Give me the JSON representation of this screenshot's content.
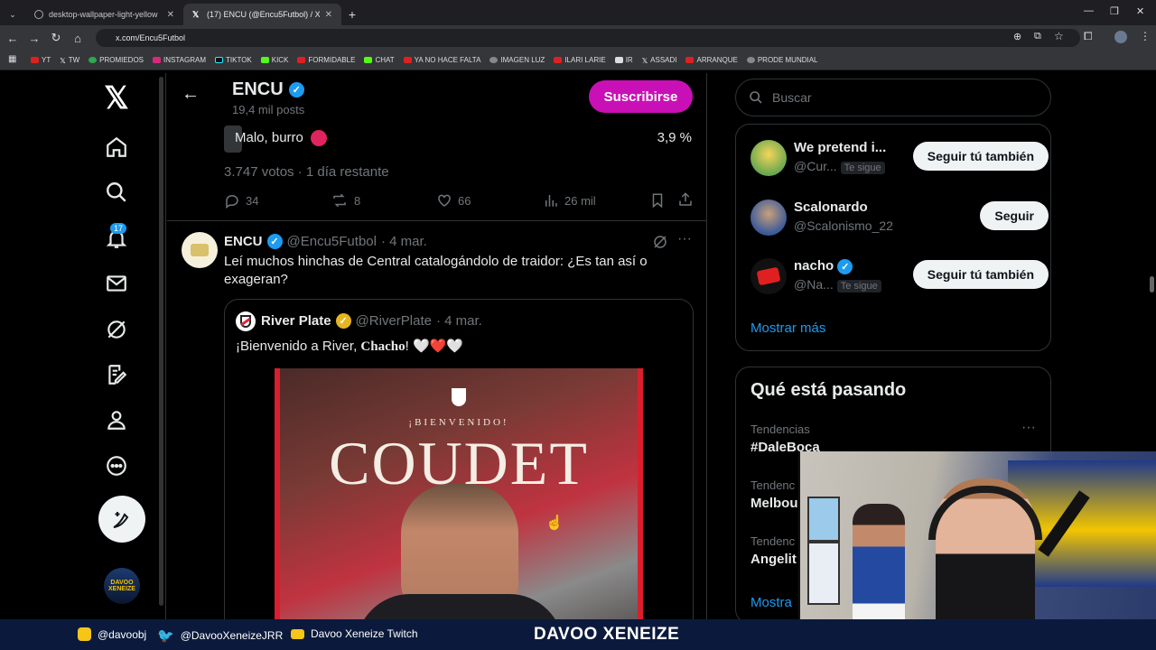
{
  "browser": {
    "tabs": [
      {
        "title": "desktop-wallpaper-light-yellow",
        "active": false
      },
      {
        "title": "(17) ENCU (@Encu5Futbol) / X",
        "active": true
      }
    ],
    "url": "x.com/Encu5Futbol",
    "bookmarks": [
      "YT",
      "TW",
      "PROMIEDOS",
      "INSTAGRAM",
      "TIKTOK",
      "KICK",
      "FORMIDABLE",
      "CHAT",
      "YA NO HACE FALTA",
      "IMAGEN LUZ",
      "ILARI LARIE",
      "IR",
      "ASSADI",
      "ARRANQUE",
      "PRODE MUNDIAL"
    ]
  },
  "nav": {
    "notifications_badge": "17"
  },
  "profile_header": {
    "name": "ENCU",
    "posts": "19,4 mil posts",
    "subscribe": "Suscribirse"
  },
  "poll": {
    "option": "Malo, burro",
    "percent": "3,9 %",
    "percent_value": 3.9,
    "meta": "3.747 votos · 1 día restante",
    "replies": "34",
    "reposts": "8",
    "likes": "66",
    "views": "26 mil"
  },
  "tweet": {
    "name": "ENCU",
    "handle": "@Encu5Futbol",
    "date": "· 4 mar.",
    "text": "Leí muchos hinchas de Central catalogándolo de traidor: ¿Es tan así o exageran?",
    "quote": {
      "name": "River Plate",
      "handle": "@RiverPlate",
      "date": "· 4 mar.",
      "text_before": "¡Bienvenido a River,",
      "text_bold": "Chacho",
      "text_after": "! 🤍❤️🤍",
      "image_subtitle": "¡BIENVENIDO!",
      "image_title": "COUDET"
    }
  },
  "sidebar": {
    "search_placeholder": "Buscar",
    "who_to_follow": [
      {
        "name": "We pretend i...",
        "handle": "@Cur...",
        "te_sigue": "Te sigue",
        "button": "Seguir tú también"
      },
      {
        "name": "Scalonardo",
        "handle": "@Scalonismo_22",
        "te_sigue": "",
        "button": "Seguir"
      },
      {
        "name": "nacho",
        "handle": "@Na...",
        "te_sigue": "Te sigue",
        "button": "Seguir tú también"
      }
    ],
    "show_more": "Mostrar más",
    "trends_title": "Qué está pasando",
    "trends": [
      {
        "category": "Tendencias",
        "name": "#DaleBoca"
      },
      {
        "category": "Tendenc",
        "name": "Melbou"
      },
      {
        "category": "Tendenc",
        "name": "Angelit"
      }
    ],
    "trends_show_more": "Mostra"
  },
  "overlay": {
    "instagram": "@davoobj",
    "twitter": "@DavooXeneizeJRR",
    "twitch": "Davoo Xeneize Twitch",
    "brand": "DAVOO XENEIZE"
  },
  "colors": {
    "accent": "#1d9bf0",
    "subscribe": "#c910b6",
    "footer": "#0b1a3c"
  }
}
